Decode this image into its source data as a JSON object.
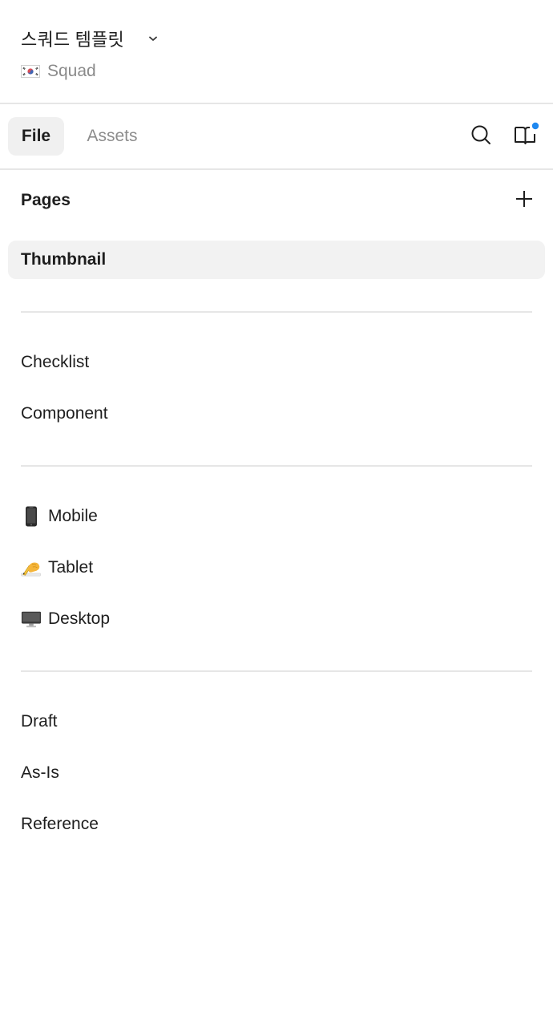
{
  "header": {
    "file_title": "스쿼드 템플릿",
    "project_name": "Squad",
    "project_flag_icon": "korea-flag-icon"
  },
  "tabs": [
    {
      "label": "File",
      "active": true
    },
    {
      "label": "Assets",
      "active": false
    }
  ],
  "toolbar": {
    "search_icon": "search-icon",
    "library_icon": "library-book-icon",
    "library_notification_color": "#1e88f0"
  },
  "pages": {
    "title": "Pages",
    "add_icon": "plus-icon",
    "items": [
      {
        "label": "Thumbnail",
        "selected": true
      },
      {
        "label": "Checklist"
      },
      {
        "label": "Component"
      },
      {
        "label": "Mobile",
        "icon": "mobile-phone-emoji-icon"
      },
      {
        "label": "Tablet",
        "icon": "writing-hand-emoji-icon"
      },
      {
        "label": "Desktop",
        "icon": "desktop-computer-emoji-icon"
      },
      {
        "label": "Draft"
      },
      {
        "label": "As-Is"
      },
      {
        "label": "Reference"
      }
    ]
  },
  "colors": {
    "selected_background": "#f2f2f2",
    "divider": "#e6e6e6",
    "muted_text": "#8a8a8a",
    "accent_blue": "#1e88f0"
  }
}
